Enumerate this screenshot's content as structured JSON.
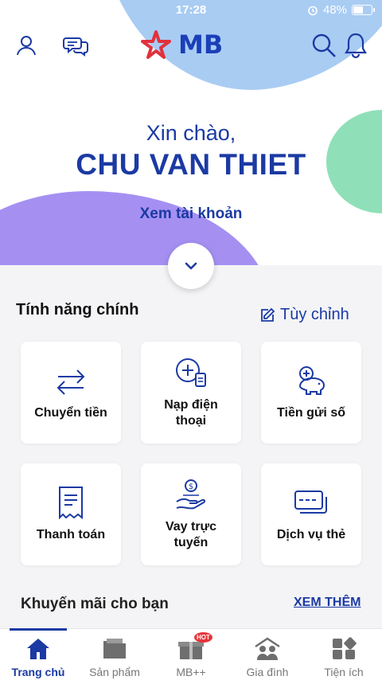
{
  "status_bar": {
    "time": "17:28",
    "battery": "48%",
    "battery_level": 0.48
  },
  "header": {
    "brand": "MB"
  },
  "greeting": {
    "hello": "Xin chào,",
    "name": "CHU VAN THIET",
    "view_account": "Xem tài khoản"
  },
  "features": {
    "title": "Tính năng chính",
    "customize": "Tùy chỉnh",
    "items": [
      {
        "label": "Chuyển tiền",
        "icon": "transfer-icon"
      },
      {
        "label": "Nạp điện thoại",
        "icon": "topup-phone-icon"
      },
      {
        "label": "Tiền gửi số",
        "icon": "piggy-bank-icon"
      },
      {
        "label": "Thanh toán",
        "icon": "receipt-icon"
      },
      {
        "label": "Vay trực tuyến",
        "icon": "loan-icon"
      },
      {
        "label": "Dịch vụ thẻ",
        "icon": "card-icon"
      }
    ]
  },
  "promo": {
    "title": "Khuyến mãi cho bạn",
    "see_more": "XEM THÊM"
  },
  "bottom_nav": {
    "items": [
      {
        "label": "Trang chủ",
        "icon": "home-icon",
        "active": true
      },
      {
        "label": "Sản phẩm",
        "icon": "folder-icon",
        "active": false
      },
      {
        "label": "MB++",
        "icon": "gift-icon",
        "active": false,
        "badge": "HOT"
      },
      {
        "label": "Gia đình",
        "icon": "family-icon",
        "active": false
      },
      {
        "label": "Tiện ích",
        "icon": "apps-icon",
        "active": false
      }
    ]
  },
  "colors": {
    "brand_blue": "#1b3aa3",
    "logo_red": "#e0323c"
  }
}
